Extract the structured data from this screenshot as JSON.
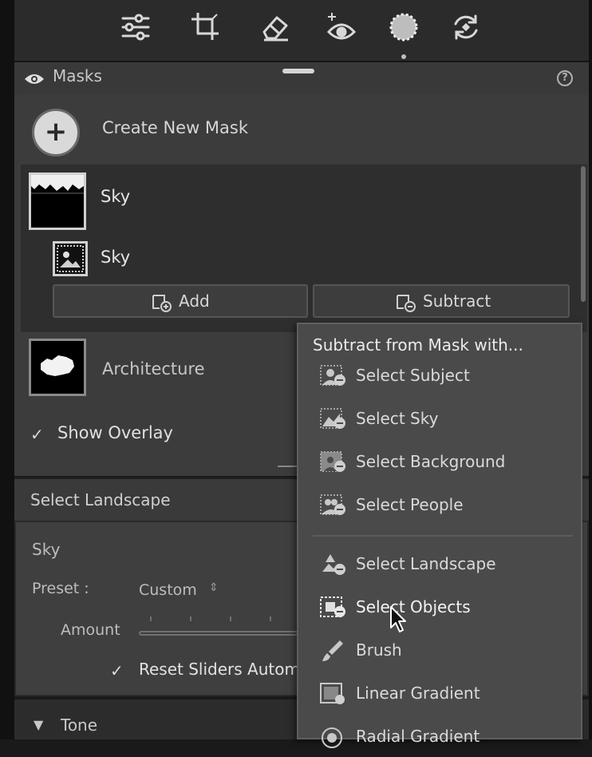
{
  "toolbar": {
    "tools": [
      {
        "icon": "edit-sliders-icon"
      },
      {
        "icon": "crop-icon"
      },
      {
        "icon": "remove-eraser-icon"
      },
      {
        "icon": "red-eye-icon"
      },
      {
        "icon": "masking-icon"
      },
      {
        "icon": "presets-icon"
      }
    ],
    "active_tool": "masking-icon"
  },
  "masks_panel": {
    "title": "Masks",
    "help": "?",
    "create_label": "Create New Mask",
    "create_symbol": "+",
    "masks": [
      {
        "name": "Sky",
        "components": [
          {
            "name": "Sky"
          }
        ],
        "add_label": "Add",
        "subtract_label": "Subtract"
      },
      {
        "name": "Architecture"
      }
    ],
    "show_overlay_label": "Show Overlay",
    "show_overlay_checked": true,
    "check_symbol": "✓"
  },
  "landscape_panel": {
    "title": "Select Landscape",
    "section": "Sky",
    "preset_label": "Preset :",
    "preset_value": "Custom",
    "preset_arrows": "⇕",
    "amount_label": "Amount",
    "reset_label": "Reset Sliders Automa",
    "tone_label": "Tone",
    "tone_arrow": "▼"
  },
  "subtract_menu": {
    "heading": "Subtract from Mask with...",
    "items_top": [
      {
        "label": "Select Subject",
        "icon": "select-subject-icon"
      },
      {
        "label": "Select Sky",
        "icon": "select-sky-icon"
      },
      {
        "label": "Select Background",
        "icon": "select-background-icon"
      },
      {
        "label": "Select People",
        "icon": "select-people-icon"
      }
    ],
    "items_bottom": [
      {
        "label": "Select Landscape",
        "icon": "select-landscape-icon"
      },
      {
        "label": "Select Objects",
        "icon": "select-objects-icon",
        "hovered": true
      },
      {
        "label": "Brush",
        "icon": "brush-icon"
      },
      {
        "label": "Linear Gradient",
        "icon": "linear-gradient-icon"
      },
      {
        "label": "Radial Gradient",
        "icon": "radial-gradient-icon"
      }
    ]
  },
  "colors": {
    "panel": "#3c3c3c",
    "menu": "#4a4a4a",
    "text": "#dcdcdc"
  }
}
